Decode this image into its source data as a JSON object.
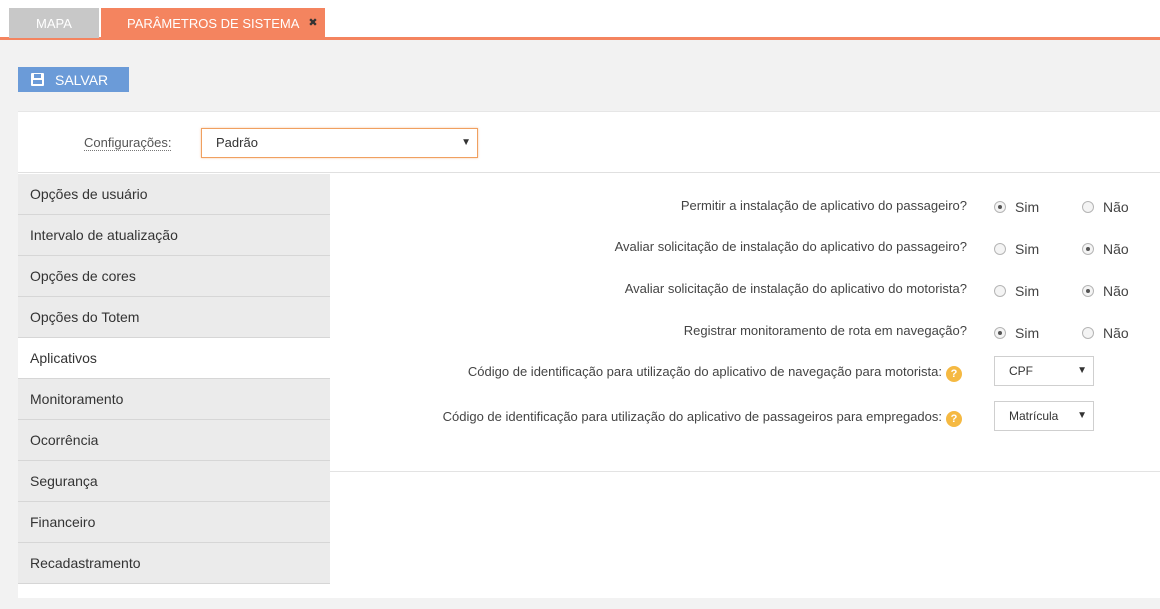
{
  "tabs": [
    {
      "label": "MAPA"
    },
    {
      "label": "PARÂMETROS DE SISTEMA",
      "close": "✖"
    }
  ],
  "toolbar": {
    "save_label": "SALVAR"
  },
  "config": {
    "label": "Configurações:",
    "value": "Padrão"
  },
  "nav": [
    {
      "label": "Opções de usuário"
    },
    {
      "label": "Intervalo de atualização"
    },
    {
      "label": "Opções de cores"
    },
    {
      "label": "Opções do Totem"
    },
    {
      "label": "Aplicativos",
      "selected": true
    },
    {
      "label": "Monitoramento"
    },
    {
      "label": "Ocorrência"
    },
    {
      "label": "Segurança"
    },
    {
      "label": "Financeiro"
    },
    {
      "label": "Recadastramento"
    }
  ],
  "form": {
    "yes_label": "Sim",
    "no_label": "Não",
    "questions": [
      {
        "label": "Permitir a instalação de aplicativo do passageiro?",
        "value": "Sim"
      },
      {
        "label": "Avaliar solicitação de instalação do aplicativo do passageiro?",
        "value": "Não"
      },
      {
        "label": "Avaliar solicitação de instalação do aplicativo do motorista?",
        "value": "Não"
      },
      {
        "label": "Registrar monitoramento de rota em navegação?",
        "value": "Sim"
      }
    ],
    "selects": [
      {
        "label": "Código de identificação para utilização do aplicativo de navegação para motorista:",
        "value": "CPF",
        "help": "?"
      },
      {
        "label": "Código de identificação para utilização do aplicativo de passageiros para empregados:",
        "value": "Matrícula",
        "help": "?"
      }
    ]
  },
  "colors": {
    "accent": "#f4845f",
    "save_button": "#6b9bd8",
    "help_icon": "#f5b942"
  }
}
